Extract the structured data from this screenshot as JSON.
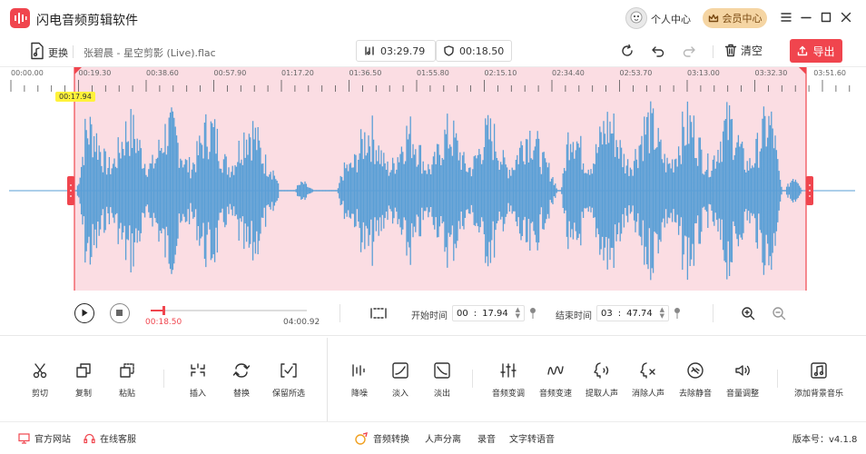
{
  "app": {
    "title": "闪电音频剪辑软件"
  },
  "header": {
    "personal_label": "个人中心",
    "vip_label": "会员中心"
  },
  "toolbar": {
    "replace_label": "更换",
    "file_name": "张碧晨 - 星空剪影 (Live).flac",
    "duration": "03:29.79",
    "selection_length": "00:18.50",
    "clear_label": "清空",
    "export_label": "导出"
  },
  "timeline": {
    "ticks": [
      "00:00.00",
      "00:19.30",
      "00:38.60",
      "00:57.90",
      "01:17.20",
      "01:36.50",
      "01:55.80",
      "02:15.10",
      "02:34.40",
      "02:53.70",
      "03:13.00",
      "03:32.30",
      "03:51.60"
    ],
    "playhead_label": "00:17.94",
    "selection_start_fraction": 0.0762,
    "selection_end_fraction": 0.955
  },
  "playback": {
    "current_time": "00:18.50",
    "total_time": "04:00.92",
    "progress_fraction": 0.08
  },
  "range": {
    "start_label": "开始时间",
    "start_min": "00",
    "start_sec": "17.94",
    "end_label": "结束时间",
    "end_min": "03",
    "end_sec": "47.74"
  },
  "tools": {
    "cut": "剪切",
    "copy": "复制",
    "paste": "粘贴",
    "insert": "插入",
    "replace": "替换",
    "keep_selected": "保留所选",
    "denoise": "降噪",
    "fade_in": "淡入",
    "fade_out": "淡出",
    "pitch_change": "音频变调",
    "speed_change": "音频变速",
    "extract_vocal": "提取人声",
    "remove_vocal": "消除人声",
    "remove_silence": "去除静音",
    "volume_adjust": "音量调整",
    "add_bgm": "添加背景音乐"
  },
  "footer": {
    "website": "官方网站",
    "support": "在线客服",
    "audio_convert": "音频转换",
    "vocal_separation": "人声分离",
    "record": "录音",
    "tts": "文字转语音",
    "version": "版本号：v4.1.8"
  },
  "colors": {
    "accent": "#f0454e",
    "waveform": "#5a9fd6",
    "selection": "#fbdde3",
    "vip": "#f5d5a3"
  }
}
